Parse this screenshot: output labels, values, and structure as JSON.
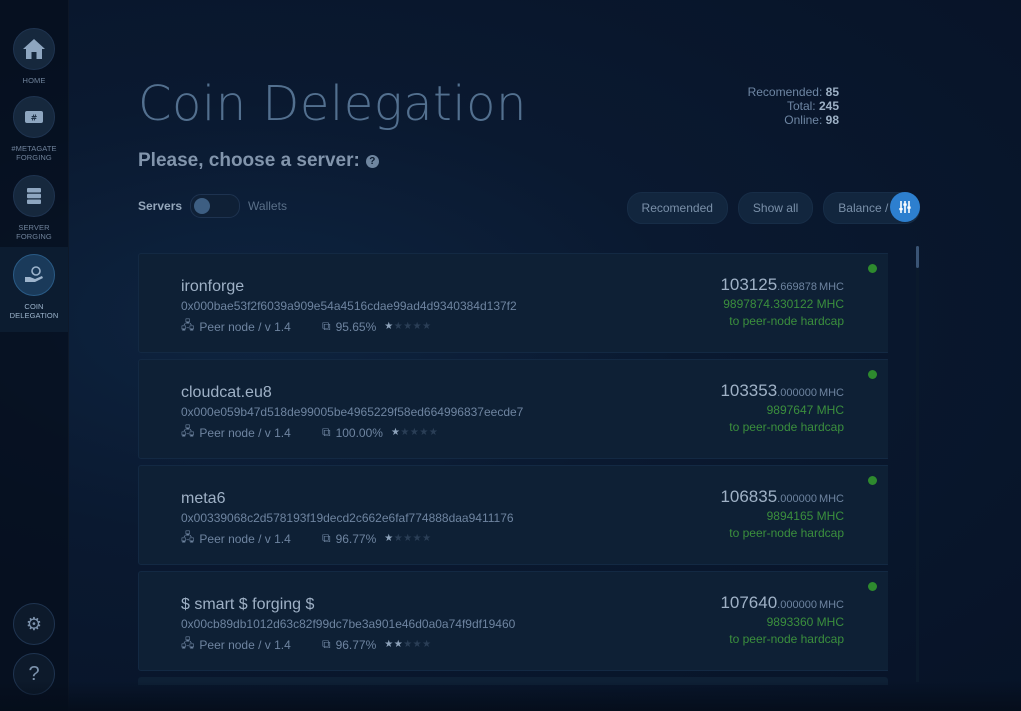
{
  "sidebar": {
    "items": [
      {
        "label": "HOME",
        "icon": "home-icon"
      },
      {
        "label": "#METAGATE FORGING",
        "icon": "wallet-icon"
      },
      {
        "label": "SERVER FORGING",
        "icon": "server-icon"
      },
      {
        "label": "COIN DELEGATION",
        "icon": "delegation-icon"
      }
    ],
    "settings_icon": "gear-icon",
    "help_label": "?"
  },
  "header": {
    "title": "Coin Delegation",
    "subtitle": "Please, choose a server:",
    "help_symbol": "?"
  },
  "stats": {
    "recommended_label": "Recomended:",
    "recommended_value": "85",
    "total_label": "Total:",
    "total_value": "245",
    "online_label": "Online:",
    "online_value": "98"
  },
  "toggle": {
    "left_label": "Servers",
    "right_label": "Wallets"
  },
  "filters": {
    "recommended": "Recomended",
    "show_all": "Show all",
    "balance": "Balance / up"
  },
  "servers": [
    {
      "name": "ironforge",
      "address": "0x000bae53f2f6039a909e54a4516cdae99ad4d9340384d137f2",
      "node": "Peer node / v 1.4",
      "percent": "95.65%",
      "stars": 1,
      "balance_int": "103125",
      "balance_dec": ".669878",
      "unit": "MHC",
      "sub_balance": "9897874.330122 MHC",
      "hardcap": "to peer-node hardcap"
    },
    {
      "name": "cloudcat.eu8",
      "address": "0x000e059b47d518de99005be4965229f58ed664996837eecde7",
      "node": "Peer node / v 1.4",
      "percent": "100.00%",
      "stars": 1,
      "balance_int": "103353",
      "balance_dec": ".000000",
      "unit": "MHC",
      "sub_balance": "9897647 MHC",
      "hardcap": "to peer-node hardcap"
    },
    {
      "name": "meta6",
      "address": "0x00339068c2d578193f19decd2c662e6faf774888daa9411176",
      "node": "Peer node / v 1.4",
      "percent": "96.77%",
      "stars": 1,
      "balance_int": "106835",
      "balance_dec": ".000000",
      "unit": "MHC",
      "sub_balance": "9894165 MHC",
      "hardcap": "to peer-node hardcap"
    },
    {
      "name": "$ smart $ forging $",
      "address": "0x00cb89db1012d63c82f99dc7be3a901e46d0a0a74f9df19460",
      "node": "Peer node / v 1.4",
      "percent": "96.77%",
      "stars": 2,
      "balance_int": "107640",
      "balance_dec": ".000000",
      "unit": "MHC",
      "sub_balance": "9893360 MHC",
      "hardcap": "to peer-node hardcap"
    }
  ],
  "colors": {
    "accent": "#2d7fcf",
    "online": "#2e8a2e",
    "green_text": "#3b8f3d"
  }
}
